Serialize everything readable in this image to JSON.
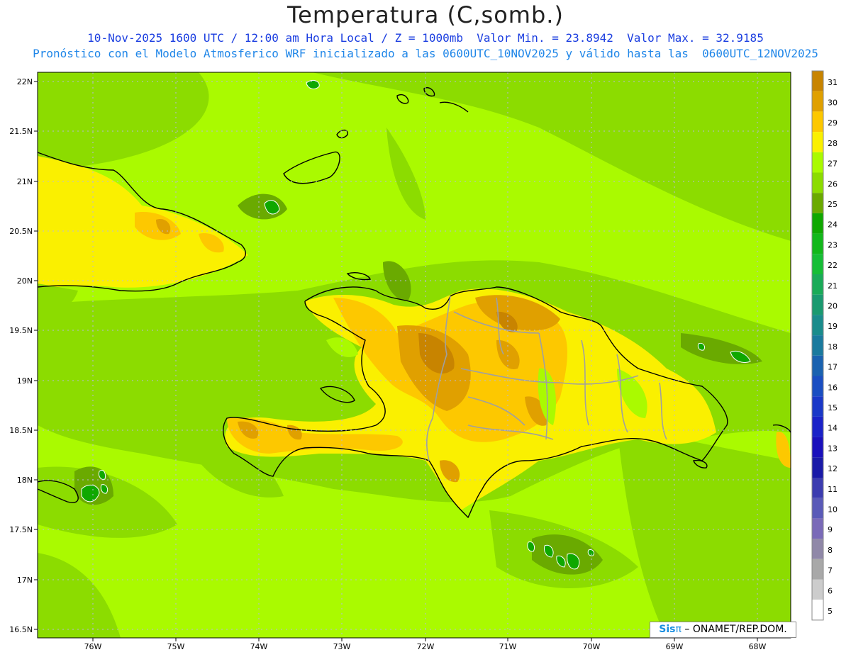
{
  "header": {
    "title": "Temperatura (C,somb.)",
    "line1": "10-Nov-2025 1600 UTC / 12:00 am Hora Local / Z = 1000mb  Valor Min. = 23.8942  Valor Max. = 32.9185",
    "line2": "Pronóstico con el Modelo Atmosferico WRF inicializado a las 0600UTC_10NOV2025 y válido hasta las  0600UTC_12NOV2025"
  },
  "map": {
    "lat_labels": [
      "22N",
      "21.5N",
      "21N",
      "20.5N",
      "20N",
      "19.5N",
      "19N",
      "18.5N",
      "18N",
      "17.5N",
      "17N",
      "16.5N"
    ],
    "lon_labels": [
      "76W",
      "75W",
      "74W",
      "73W",
      "72W",
      "71W",
      "70W",
      "69W",
      "68W"
    ],
    "features": [
      "Cuba",
      "Haiti",
      "Dominican Republic",
      "Jamaica",
      "Puerto Rico",
      "Bahamas islands"
    ]
  },
  "legend": {
    "levels": [
      31,
      30,
      29,
      28,
      27,
      26,
      25,
      24,
      23,
      22,
      21,
      20,
      19,
      18,
      17,
      16,
      15,
      14,
      13,
      12,
      11,
      10,
      9,
      8,
      7,
      6,
      5
    ],
    "colors": [
      "#c88400",
      "#e0a000",
      "#fdc800",
      "#faf000",
      "#aafa00",
      "#8cdc00",
      "#6aaa00",
      "#0fa800",
      "#12b81a",
      "#16be36",
      "#1aab58",
      "#1a9a70",
      "#1a8c8c",
      "#1a7a9e",
      "#1a62b0",
      "#1a4ec2",
      "#1a38c8",
      "#1a22c8",
      "#1a10bc",
      "#1a1aa8",
      "#3c3cb0",
      "#5a5ab8",
      "#7a6ab8",
      "#9088a8",
      "#a8a8a8",
      "#cccccc",
      "#ffffff"
    ]
  },
  "credit": {
    "logo": "Sis",
    "pi": "π",
    "text": "– ONAMET/REP.DOM."
  }
}
